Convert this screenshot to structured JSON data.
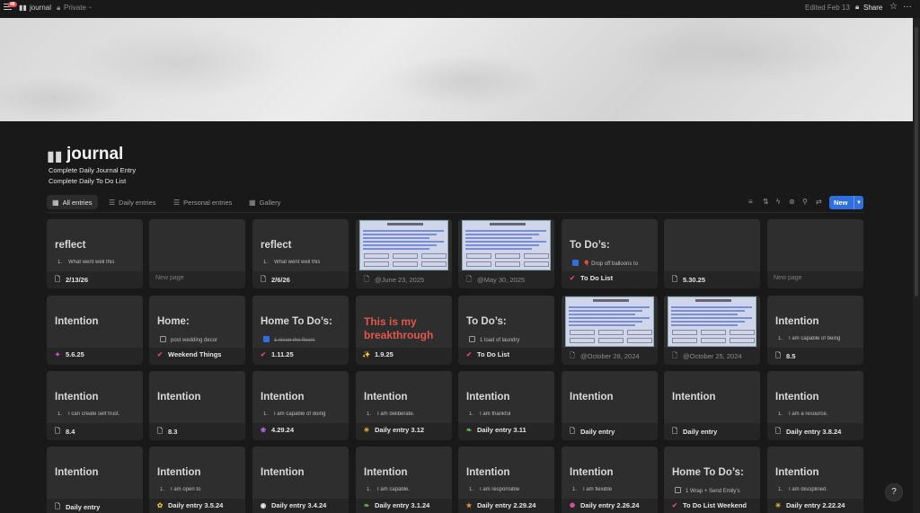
{
  "topbar": {
    "notification_count": "48",
    "page_name": "journal",
    "visibility": "Private",
    "edited": "Edited Feb 13",
    "share_label": "Share"
  },
  "page": {
    "title": "journal",
    "description_lines": [
      "Complete Daily Journal Entry",
      "Complete Daily To Do List"
    ]
  },
  "tabs": [
    {
      "label": "All entries",
      "icon": "grid-icon",
      "active": true
    },
    {
      "label": "Daily entries",
      "icon": "list-icon",
      "active": false
    },
    {
      "label": "Personal entries",
      "icon": "list-icon",
      "active": false
    },
    {
      "label": "Gallery",
      "icon": "grid-icon",
      "active": false
    }
  ],
  "toolbar": {
    "new_label": "New",
    "accent": "#2f6fe0"
  },
  "cards": [
    {
      "heading": "reflect",
      "line": "What went well this",
      "line_type": "num",
      "footer": "2/13/26",
      "footer_icon": "page-icon"
    },
    {
      "new_page": "New page"
    },
    {
      "heading": "reflect",
      "line": "What went well this",
      "line_type": "num",
      "footer": "2/6/26",
      "footer_icon": "page-icon"
    },
    {
      "thumbnail": true,
      "footer": "@June 23, 2025",
      "footer_icon": "page-icon",
      "muted": true
    },
    {
      "thumbnail": true,
      "footer": "@May 30, 2025",
      "footer_icon": "page-icon",
      "muted": true
    },
    {
      "heading": "To Do’s:",
      "line": "🎈 Drop off balloons to",
      "line_type": "check-on",
      "footer": "To Do List",
      "footer_icon": "check-circle-icon"
    },
    {
      "footer": "5.30.25",
      "footer_icon": "page-icon"
    },
    {
      "new_page": "New page"
    },
    {
      "heading": "Intention",
      "footer": "5.6.25",
      "footer_icon": "sparkle-square-icon"
    },
    {
      "heading": "Home:",
      "line": "post wedding decor",
      "line_type": "check",
      "footer": "Weekend Things",
      "footer_icon": "check-circle-icon"
    },
    {
      "heading": "Home To Do’s:",
      "line": "1 clean the floors",
      "line_type": "check-on-strike",
      "footer": "1.11.25",
      "footer_icon": "check-circle-icon"
    },
    {
      "heading": "This is my breakthrough",
      "heading_red": true,
      "footer": "1.9.25",
      "footer_icon": "sparkles-icon"
    },
    {
      "heading": "To Do’s:",
      "line": "1 load of laundry",
      "line_type": "check",
      "footer": "To Do List",
      "footer_icon": "check-circle-icon"
    },
    {
      "thumbnail": true,
      "footer": "@October 28, 2024",
      "footer_icon": "page-icon",
      "muted": true
    },
    {
      "thumbnail": true,
      "footer": "@October 25, 2024",
      "footer_icon": "page-icon",
      "muted": true
    },
    {
      "heading": "Intention",
      "line": "I am capable of being",
      "line_type": "num",
      "footer": "8.5",
      "footer_icon": "page-icon"
    },
    {
      "heading": "Intention",
      "line": "I can create self trust.",
      "line_type": "num",
      "footer": "8.4",
      "footer_icon": "page-icon"
    },
    {
      "heading": "Intention",
      "footer": "8.3",
      "footer_icon": "page-icon"
    },
    {
      "heading": "Intention",
      "line": "I am capable of doing",
      "line_type": "num",
      "footer": "4.29.24",
      "footer_icon": "flower-icon"
    },
    {
      "heading": "Intention",
      "line": "I am deliberate.",
      "line_type": "num",
      "footer": "Daily entry 3.12",
      "footer_icon": "sun-icon"
    },
    {
      "heading": "Intention",
      "line": "I am thankful",
      "line_type": "num",
      "footer": "Daily entry 3.11",
      "footer_icon": "leaf-icon"
    },
    {
      "heading": "Intention",
      "footer": "Daily entry",
      "footer_icon": "page-icon"
    },
    {
      "heading": "Intention",
      "footer": "Daily entry",
      "footer_icon": "page-icon"
    },
    {
      "heading": "Intention",
      "line": "I am a resource.",
      "line_type": "num",
      "footer": "Daily entry 3.8.24",
      "footer_icon": "page-icon"
    },
    {
      "heading": "Intention",
      "footer": "Daily entry",
      "footer_icon": "page-icon"
    },
    {
      "heading": "Intention",
      "line": "I am open to",
      "line_type": "num",
      "footer": "Daily entry 3.5.24",
      "footer_icon": "sunflower-icon"
    },
    {
      "heading": "Intention",
      "footer": "Daily entry 3.4.24",
      "footer_icon": "circle-dot-icon"
    },
    {
      "heading": "Intention",
      "line": "I am capable.",
      "line_type": "num",
      "footer": "Daily entry 3.1.24",
      "footer_icon": "leaf-icon"
    },
    {
      "heading": "Intention",
      "line": "I am responsible",
      "line_type": "num",
      "footer": "Daily entry 2.29.24",
      "footer_icon": "star-icon"
    },
    {
      "heading": "Intention",
      "line": "I am flexible",
      "line_type": "num",
      "footer": "Daily entry 2.26.24",
      "footer_icon": "gear-icon"
    },
    {
      "heading": "Home To Do’s:",
      "line": "1 Wrap + Send Emily’s",
      "line_type": "check",
      "footer": "To Do List Weekend",
      "footer_icon": "check-circle-icon"
    },
    {
      "heading": "Intention",
      "line": "I am disciplined.",
      "line_type": "num",
      "footer": "Daily entry 2.22.24",
      "footer_icon": "sun-icon"
    }
  ]
}
